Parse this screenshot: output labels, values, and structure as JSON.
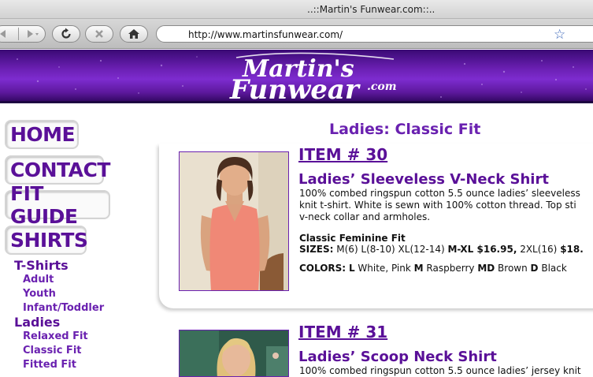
{
  "window": {
    "title": "..::Martin's Funwear.com::.."
  },
  "toolbar": {
    "url": "http://www.martinsfunwear.com/"
  },
  "banner": {
    "logo_line1": "Martin's",
    "logo_line2": "Funwear",
    "logo_suffix": ".com"
  },
  "sidebar": {
    "main": [
      "HOME",
      "CONTACT",
      "FIT GUIDE",
      "SHIRTS"
    ],
    "groups": [
      {
        "label": "T-Shirts",
        "items": [
          "Adult",
          "Youth",
          "Infant/Toddler"
        ]
      },
      {
        "label": "Ladies",
        "items": [
          "Relaxed Fit",
          "Classic Fit",
          "Fitted Fit"
        ]
      }
    ]
  },
  "main": {
    "title": "Ladies: Classic Fit",
    "products": [
      {
        "item": "ITEM # 30",
        "name": "Ladies’ Sleeveless V-Neck Shirt",
        "desc": [
          "100% combed ringspun cotton 5.5 ounce ladies’ sleeveless",
          "knit t-shirt. White is sewn with 100% cotton thread. Top sti",
          "v-neck collar and armholes."
        ],
        "fit": "Classic Feminine Fit",
        "sizes_label": "SIZES:",
        "sizes_a": " M(6) L(8-10) XL(12-14) ",
        "sizes_b": "M-XL",
        "sizes_c": " $16.95,",
        "sizes_d": " 2XL(16) ",
        "sizes_e": "$18.",
        "colors_label": "COLORS:",
        "colors": [
          {
            "code": "L",
            "name": "White, Pink"
          },
          {
            "code": "M",
            "name": "Raspberry"
          },
          {
            "code": "MD",
            "name": "Brown"
          },
          {
            "code": "D",
            "name": "Black"
          }
        ]
      },
      {
        "item": "ITEM # 31",
        "name": "Ladies’ Scoop Neck Shirt",
        "desc": [
          "100% combed ringspun cotton 5.5 ounce ladies’ jersey knit"
        ]
      }
    ]
  },
  "colors": {
    "accent": "#5a1098",
    "banner": "#6a1fb2"
  }
}
